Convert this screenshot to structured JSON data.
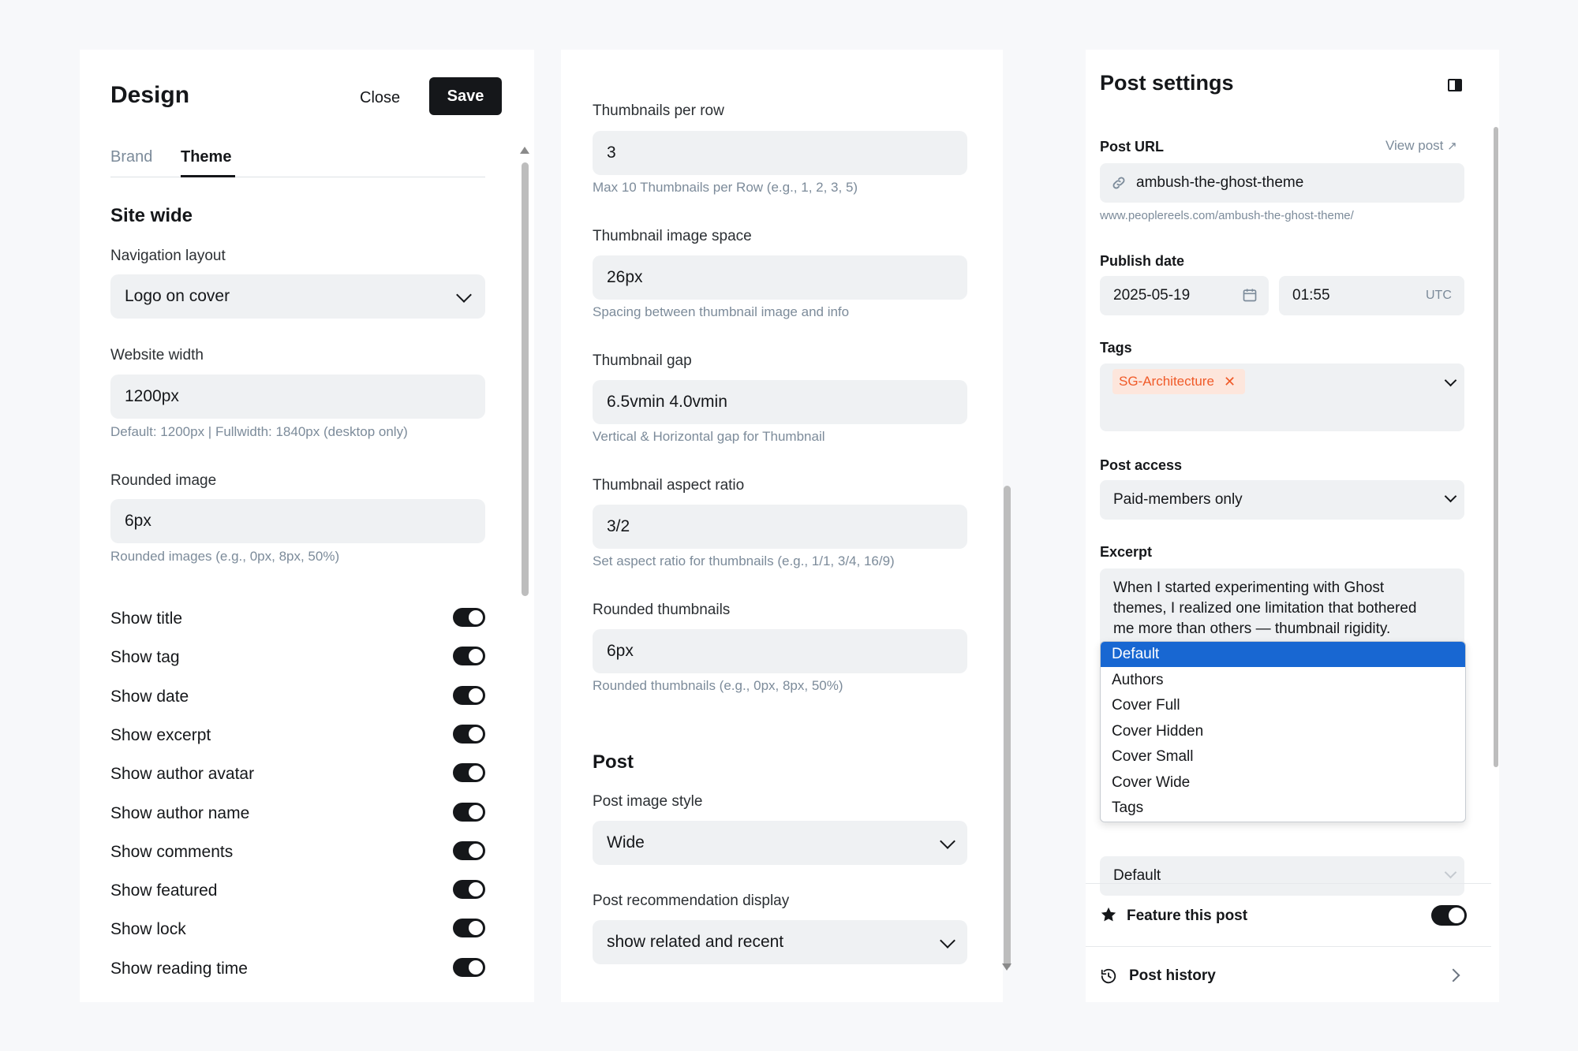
{
  "design": {
    "title": "Design",
    "close_label": "Close",
    "save_label": "Save",
    "tabs": [
      {
        "label": "Brand"
      },
      {
        "label": "Theme"
      }
    ],
    "site_wide_heading": "Site wide",
    "navigation_layout": {
      "label": "Navigation layout",
      "value": "Logo on cover"
    },
    "website_width": {
      "label": "Website width",
      "value": "1200px",
      "hint": "Default: 1200px | Fullwidth: 1840px (desktop only)"
    },
    "rounded_image": {
      "label": "Rounded image",
      "value": "6px",
      "hint": "Rounded images (e.g., 0px, 8px, 50%)"
    },
    "toggles": [
      {
        "label": "Show title",
        "on": true
      },
      {
        "label": "Show tag",
        "on": true
      },
      {
        "label": "Show date",
        "on": true
      },
      {
        "label": "Show excerpt",
        "on": true
      },
      {
        "label": "Show author avatar",
        "on": true
      },
      {
        "label": "Show author name",
        "on": true
      },
      {
        "label": "Show comments",
        "on": true
      },
      {
        "label": "Show featured",
        "on": true
      },
      {
        "label": "Show lock",
        "on": true
      },
      {
        "label": "Show reading time",
        "on": true
      }
    ]
  },
  "middle": {
    "thumbnails_per_row": {
      "label": "Thumbnails per row",
      "value": "3",
      "hint": "Max 10 Thumbnails per Row (e.g., 1, 2, 3, 5)"
    },
    "thumbnail_image_space": {
      "label": "Thumbnail image space",
      "value": "26px",
      "hint": "Spacing between thumbnail image and info"
    },
    "thumbnail_gap": {
      "label": "Thumbnail gap",
      "value": "6.5vmin 4.0vmin",
      "hint": "Vertical & Horizontal gap for Thumbnail"
    },
    "thumbnail_aspect_ratio": {
      "label": "Thumbnail aspect ratio",
      "value": "3/2",
      "hint": "Set aspect ratio for thumbnails (e.g., 1/1, 3/4, 16/9)"
    },
    "rounded_thumbnails": {
      "label": "Rounded thumbnails",
      "value": "6px",
      "hint": "Rounded thumbnails (e.g., 0px, 8px, 50%)"
    },
    "post_heading": "Post",
    "post_image_style": {
      "label": "Post image style",
      "value": "Wide"
    },
    "post_recommendation": {
      "label": "Post recommendation display",
      "value": "show related and recent"
    }
  },
  "post_settings": {
    "title": "Post settings",
    "post_url": {
      "label": "Post URL",
      "view_post": "View post",
      "value": "ambush-the-ghost-theme",
      "full_url": "www.peoplereels.com/ambush-the-ghost-theme/"
    },
    "publish_date": {
      "label": "Publish date",
      "date": "2025-05-19",
      "time": "01:55",
      "tz": "UTC"
    },
    "tags": {
      "label": "Tags",
      "tag": "SG-Architecture"
    },
    "post_access": {
      "label": "Post access",
      "value": "Paid-members only"
    },
    "excerpt": {
      "label": "Excerpt",
      "lines": [
        "When I started experimenting with Ghost",
        "themes, I realized one limitation that bothered",
        "me more than others — thumbnail rigidity."
      ]
    },
    "template_value": "Default",
    "template_options": [
      "Default",
      "Authors",
      "Cover Full",
      "Cover Hidden",
      "Cover Small",
      "Cover Wide",
      "Tags"
    ],
    "feature_label": "Feature this post",
    "history_label": "Post history"
  },
  "colors": {
    "accent": "#15171a",
    "select_blue": "#1867d2",
    "tag_bg": "#fde6dc",
    "tag_text": "#f05a28"
  }
}
